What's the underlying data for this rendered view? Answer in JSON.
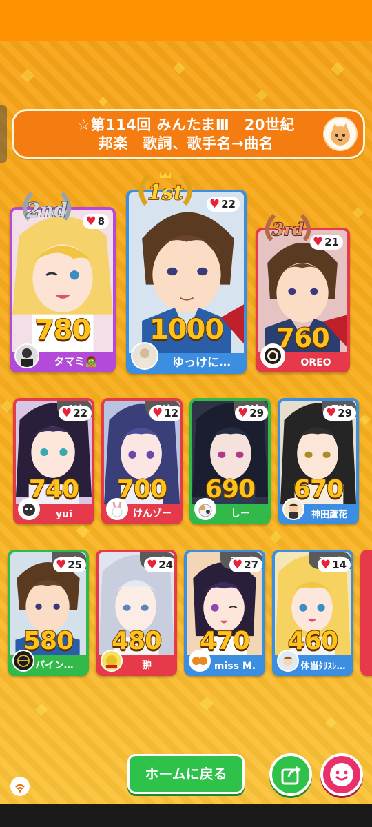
{
  "title": {
    "line1": "☆第114回 みんたまⅢ　20世紀",
    "line2": "邦楽　歌詞、歌手名→曲名"
  },
  "top3": [
    {
      "rank": "1st",
      "score": "1000",
      "likes": "22",
      "name": "ゆっけに…",
      "accent": "#3b8ee0"
    },
    {
      "rank": "2nd",
      "score": "780",
      "likes": "8",
      "name": "タマミ🧟",
      "accent": "#b44bd8"
    },
    {
      "rank": "3rd",
      "score": "760",
      "likes": "21",
      "name": "OREO",
      "accent": "#e6394a"
    }
  ],
  "row2": [
    {
      "rank": "4th",
      "score": "740",
      "likes": "22",
      "name": "yui",
      "accent": "#e6394a"
    },
    {
      "rank": "5th",
      "score": "700",
      "likes": "12",
      "name": "けんゾー",
      "accent": "#e6394a"
    },
    {
      "rank": "6th",
      "score": "690",
      "likes": "29",
      "name": "しー",
      "accent": "#31b94a"
    },
    {
      "rank": "7th",
      "score": "670",
      "likes": "29",
      "name": "神田蘆花",
      "accent": "#3b8ee0"
    }
  ],
  "row3": [
    {
      "rank": "8th",
      "score": "580",
      "likes": "25",
      "name": "パインフ…",
      "accent": "#31b94a"
    },
    {
      "rank": "9th",
      "score": "480",
      "likes": "24",
      "name": "翀",
      "accent": "#e6394a"
    },
    {
      "rank": "10th",
      "score": "470",
      "likes": "27",
      "name": "miss M.",
      "accent": "#3b8ee0"
    },
    {
      "rank": "11th",
      "score": "460",
      "likes": "14",
      "name": "体当ﾀﾘｽﾚ…",
      "accent": "#3b8ee0"
    }
  ],
  "buttons": {
    "home_label": "ホームに戻る",
    "share_icon": "share-icon",
    "reaction_icon": "smile-icon"
  },
  "colors": {
    "status_bar": "#ff9200",
    "title_bar": "#f47c10",
    "green_button": "#2fc24b",
    "pink_button": "#e8306a",
    "score_gold": "#ffc21a"
  }
}
